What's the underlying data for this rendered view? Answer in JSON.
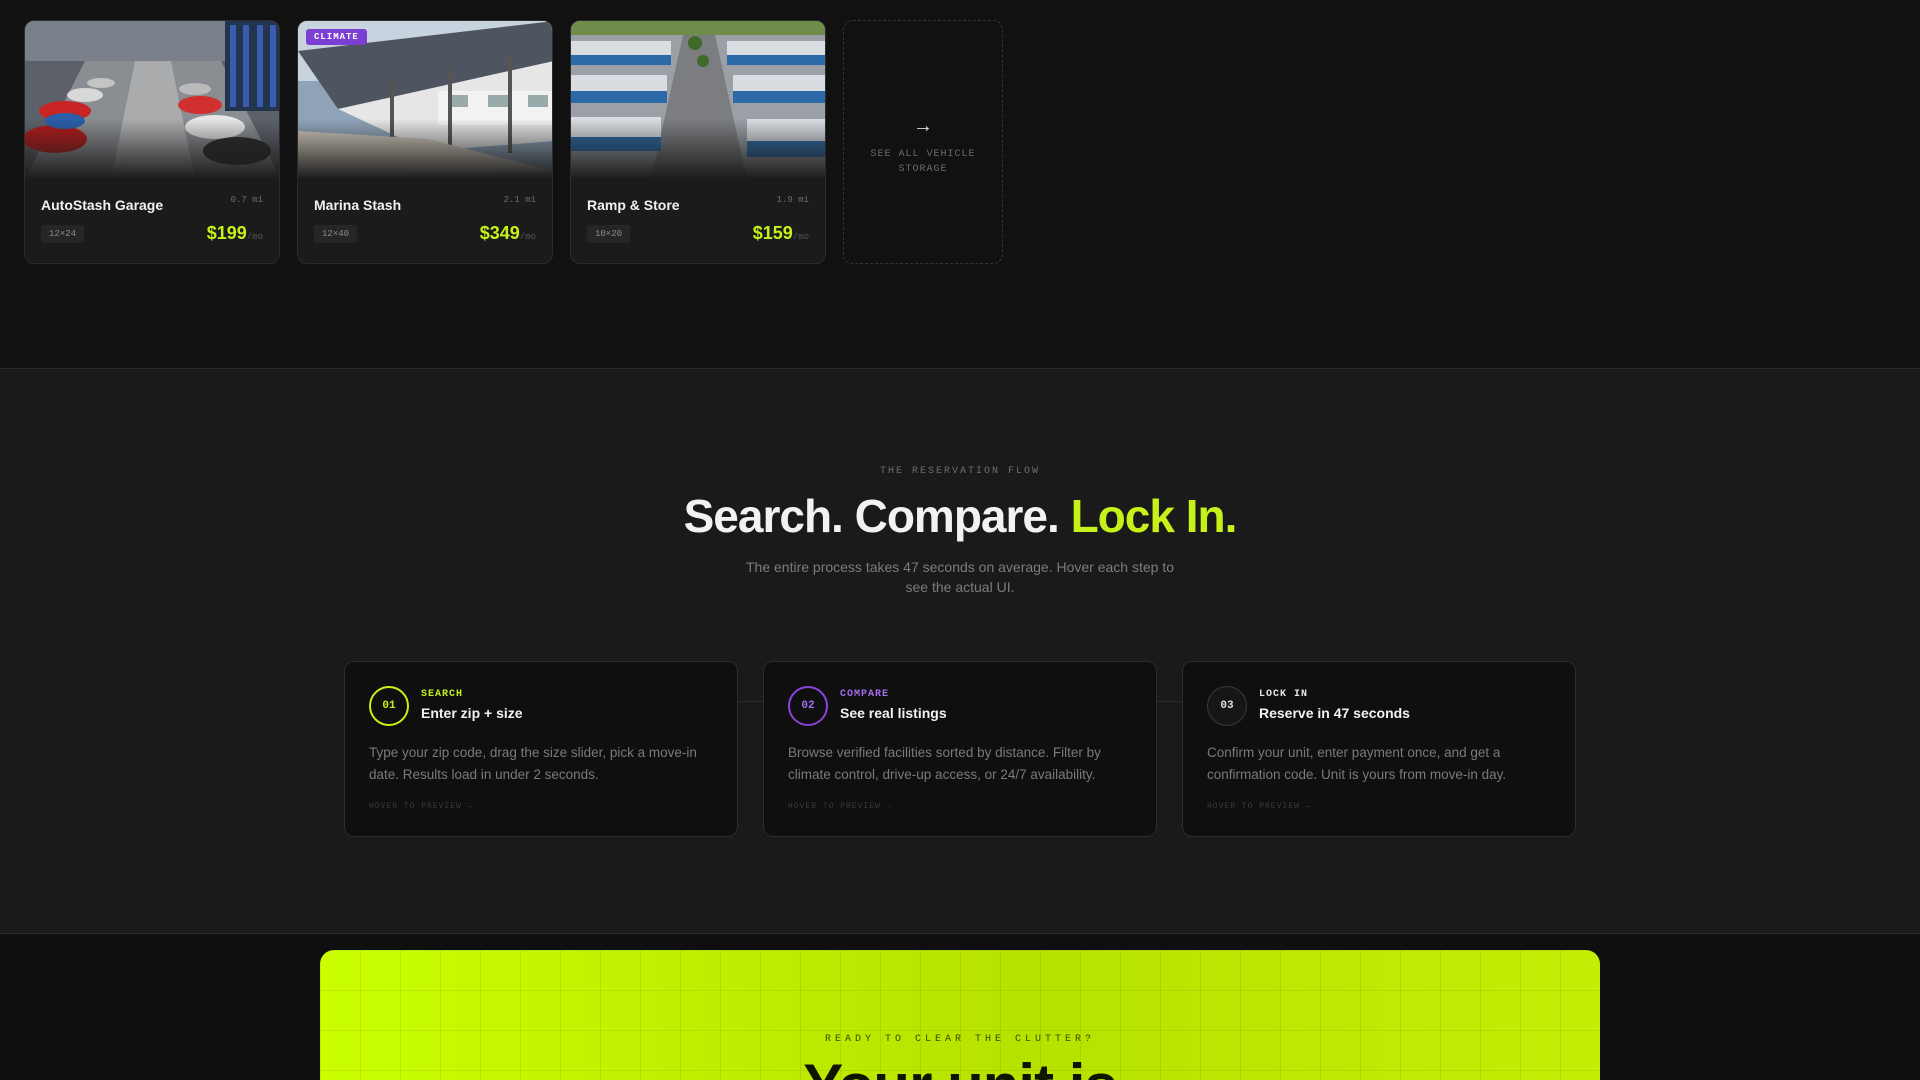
{
  "listings": [
    {
      "name": "AutoStash Garage",
      "distance": "0.7 mi",
      "size": "12×24",
      "price": "$199",
      "period": "/mo",
      "tag": ""
    },
    {
      "name": "Marina Stash",
      "distance": "2.1 mi",
      "size": "12×40",
      "price": "$349",
      "period": "/mo",
      "tag": "CLIMATE"
    },
    {
      "name": "Ramp & Store",
      "distance": "1.9 mi",
      "size": "10×20",
      "price": "$159",
      "period": "/mo",
      "tag": ""
    }
  ],
  "see_all": {
    "arrow": "→",
    "label": "SEE ALL VEHICLE STORAGE"
  },
  "flow": {
    "eyebrow": "THE RESERVATION FLOW",
    "headline_main": "Search. Compare.",
    "headline_accent": "Lock In.",
    "subtitle": "The entire process takes 47 seconds on average. Hover each step to see the actual UI.",
    "steps": [
      {
        "num": "01",
        "kicker": "SEARCH",
        "kicker_color": "#c6f21a",
        "title": "Enter zip + size",
        "desc": "Type your zip code, drag the size slider, pick a move-in date. Results load in under 2 seconds.",
        "hint": "HOVER TO PREVIEW →"
      },
      {
        "num": "02",
        "kicker": "COMPARE",
        "kicker_color": "#a46ef0",
        "title": "See real listings",
        "desc": "Browse verified facilities sorted by distance. Filter by climate control, drive-up access, or 24/7 availability.",
        "hint": "HOVER TO PREVIEW →"
      },
      {
        "num": "03",
        "kicker": "LOCK IN",
        "kicker_color": "#e8e8e8",
        "title": "Reserve in 47 seconds",
        "desc": "Confirm your unit, enter payment once, and get a confirmation code. Unit is yours from move-in day.",
        "hint": "HOVER TO PREVIEW →"
      }
    ]
  },
  "cta": {
    "eyebrow": "READY TO CLEAR THE CLUTTER?",
    "title": "Your unit is"
  },
  "colors": {
    "accent": "#c6f21a",
    "purple": "#8a44d8",
    "background": "#0f0f0f"
  }
}
